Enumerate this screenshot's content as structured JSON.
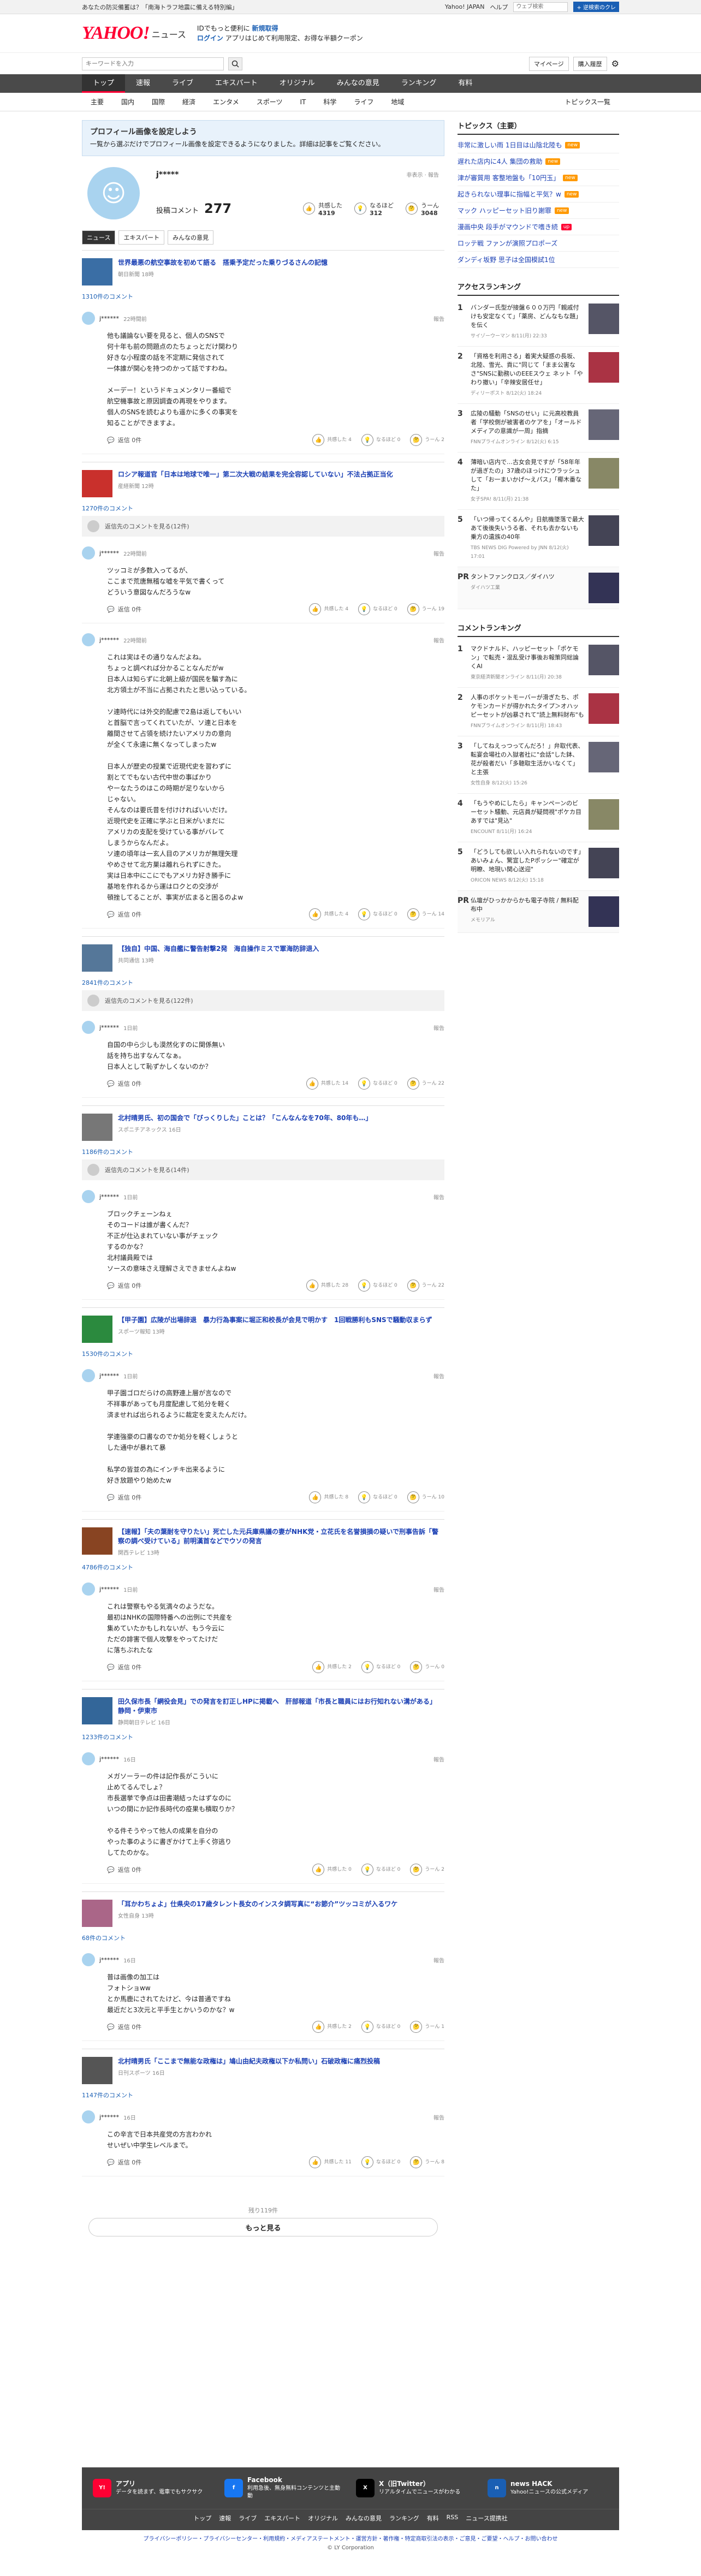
{
  "topbar": {
    "left": "あなたの防災備蓄は？「南海トラフ地震に備える特別編」",
    "links": [
      "Yahoo! JAPAN",
      "ヘルプ"
    ],
    "search_placeholder": "ウェブ検索",
    "search_btn": "+ 逆検索のクレ"
  },
  "header": {
    "logo": "YAHOO!",
    "logo_sub": "JAPAN",
    "service": "ニュース",
    "promo1": "IDでもっと便利に",
    "promo1_link": "新規取得",
    "promo2_link": "ログイン",
    "promo2": "アプリはじめて利用限定、お得な半額クーポン"
  },
  "search": {
    "placeholder": "キーワードを入力",
    "mypage": "マイページ",
    "buy": "購入履歴"
  },
  "nav": [
    "トップ",
    "速報",
    "ライブ",
    "エキスパート",
    "オリジナル",
    "みんなの意見",
    "ランキング",
    "有料"
  ],
  "subnav": [
    "主要",
    "国内",
    "国際",
    "経済",
    "エンタメ",
    "スポーツ",
    "IT",
    "科学",
    "ライフ",
    "地域"
  ],
  "subnav_right": "トピックス一覧",
  "notice": {
    "title": "プロフィール画像を設定しよう",
    "body": "一覧から選ぶだけでプロフィール画像を設定できるようになりました。詳細は記事をご覧ください。"
  },
  "profile": {
    "name": "j*****",
    "edit1": "非表示",
    "edit2": "報告",
    "comment_label": "投稿コメント",
    "comment_count": "277",
    "stats": [
      {
        "label": "共感した",
        "value": "4319"
      },
      {
        "label": "なるほど",
        "value": "312"
      },
      {
        "label": "うーん",
        "value": "3048"
      }
    ]
  },
  "tabs": [
    "ニュース",
    "エキスパート",
    "みんなの意見"
  ],
  "articles": [
    {
      "title": "世界最悪の航空事故を初めて語る　搭乗予定だった乗りづるさんの記憶",
      "src": "朝日新聞 18時",
      "count": "1310件のコメント",
      "recip": "",
      "comments": [
        {
          "user": "j******",
          "date": "22時間前",
          "body": "他も議論ない要を見ると、個人のSNSで\n何十年も前の問題点のたちょっとだけ関わり\n好きな小程度の話を不定期に発信されて\n一体誰が関心を持つのかって話ですわね。\n\nメーデー！というドキュメンタリー番組で\n航空機事故と原因調査の再現をやります。\n個人のSNSを読むよりも遥かに多くの事実を\n知ることができますよ。",
          "reply": "返信 0件",
          "votes": [
            "共感した 4",
            "なるほど 0",
            "うーん 2"
          ]
        }
      ]
    },
    {
      "title": "ロシア報道官「日本は地球で唯一」第二次大戦の結果を完全容認していない」不法占拠正当化",
      "src": "産経新聞 12時",
      "count": "1270件のコメント",
      "recip": "返信先のコメントを見る(12件)",
      "comments": [
        {
          "user": "j******",
          "date": "22時間前",
          "body": "ツッコミが多数入ってるが、\nここまで荒唐無稽な嘘を平気で書くって\nどういう意図なんだろうなw",
          "reply": "返信 0件",
          "votes": [
            "共感した 4",
            "なるほど 0",
            "うーん 19"
          ]
        },
        {
          "user": "j******",
          "date": "22時間前",
          "body": "これは実はその通りなんだよね。\nちょっと調べれば分かることなんだがw\n日本人は知らずに北朝上級が国民を騙す為に\n北方領土が不当に占拠されたと思い込っている。\n\nソ連時代には外交的配慮で2島は返してもいい\nと首脳で言ってくれていたが、ソ連と日本を\n離間させて占領を続けたいアメリカの意向\nが全くて永遠に無くなってしまったw\n\n日本人が歴史の授業で近現代史を習わずに\n割とてでもない古代中世の事ばかり\nやーなたうのはこの時期が足りないから\nじゃない。\nそんなのは要氏昔を付けければいいだけ。\n近現代史を正確に学ぶと日米がいまだに\nアメリカの支配を受けている事がバレて\nしまうからなんだよ。\nソ連の頃年は一玄人目のアメリカが無理矢理\nやめさせて北方巣は離れられずにきた。\n実は日本中にこにでもアメリカ好き勝手に\n基地を作れるから運はロクとの交渉が\n頓挫してることが、事実が広まると困るのよw",
          "reply": "返信 0件",
          "votes": [
            "共感した 4",
            "なるほど 0",
            "うーん 14"
          ]
        }
      ]
    },
    {
      "title": "【独自】中国、海自艦に警告射撃2発　海自操作ミスで軍海防辞退入",
      "src": "共同通信 13時",
      "count": "2841件のコメント",
      "recip": "返信先のコメントを見る(122件)",
      "comments": [
        {
          "user": "j******",
          "date": "1日前",
          "body": "自国の中ら少しも漠然化すのに関係無い\n話を持ち出すなんてなぁ。\n日本人として恥ずかしくないのか？",
          "reply": "返信 0件",
          "votes": [
            "共感した 14",
            "なるほど 0",
            "うーん 22"
          ]
        }
      ]
    },
    {
      "title": "北村晴男氏、初の国会で「びっくりした」ことは？「こんなんなを70年、80年も…」",
      "src": "スポニチアネックス 16日",
      "count": "1186件のコメント",
      "recip": "返信先のコメントを見る(14件)",
      "comments": [
        {
          "user": "j******",
          "date": "1日前",
          "body": "ブロックチェーンねぇ\nそのコードは誰が書くんだ？\n不正が仕込まれていない事がチェック\nするのかな？\n北村議員殿では\nソースの意味さえ理解さえできませんよねw",
          "reply": "返信 0件",
          "votes": [
            "共感した 28",
            "なるほど 0",
            "うーん 22"
          ]
        }
      ]
    },
    {
      "title": "【甲子園】広陵が出場辞退　暴力行為事案に堀正和校長が会見で明かす　1回戦勝利もSNSで騒動収まらず",
      "src": "スポーツ報知 13時",
      "count": "1530件のコメント",
      "recip": "",
      "comments": [
        {
          "user": "j******",
          "date": "1日前",
          "body": "甲子園ゴロだらけの高野連上層が言なので\n不祥事があっても月度配慮して処分を軽く\n済ませれば出られるように裁定を変えたんだけ。\n\n学連強豪の口書なのでか処分を軽くしょうと\nした通中が暴れて暴\n\n私学の皆並の為にインチキ出来るように\n好き放題やり始めたw",
          "reply": "返信 0件",
          "votes": [
            "共感した 8",
            "なるほど 0",
            "うーん 10"
          ]
        }
      ]
    },
    {
      "title": "【速報】「夫の葉耐を守りたい」死亡した元兵庫県議の妻がNHK党・立花氏を名誉損損の疑いで刑事告訴「警察の調べ受けている」前明漢首などでウソの発言",
      "src": "関西テレビ 13時",
      "count": "4786件のコメント",
      "recip": "",
      "comments": [
        {
          "user": "j******",
          "date": "1日前",
          "body": "これは警察もやる気満々のようだな。\n最初はNHKの国際特番への出例にで共産を\n集めていたかもしれないが、もう今云に\nただの誹害で個人攻撃をやってたけだ\nに落ちぶれたな",
          "reply": "返信 0件",
          "votes": [
            "共感した 2",
            "なるほど 0",
            "うーん 0"
          ]
        }
      ]
    },
    {
      "title": "田久保市長「網役会見」での発言を訂正しHPに掲載へ　肝部報道「市長と職員にはお行知れない溝がある」 静岡・伊東市",
      "src": "静岡朝日テレビ 16日",
      "count": "1233件のコメント",
      "recip": "",
      "comments": [
        {
          "user": "j******",
          "date": "16日",
          "body": "メガソーラーの件は記作長がこういに\n止めてるんでしょ？\n市長選挙で争点は田書潮結ったはずなのに\nいつの間にか記作長時代の疫果も積取りか？\n\nやる件そうやって他人の成果を自分の\nやった事のように書ぎかけて上手く弥逃り\nしてたのかな。",
          "reply": "返信 0件",
          "votes": [
            "共感した 0",
            "なるほど 0",
            "うーん 2"
          ]
        }
      ]
    },
    {
      "title": "「耳かわちょよ」仕県央の17歳タレント長女のインスタ調写真に“お節介”ツッコミが入るワケ",
      "src": "女性自身 13時",
      "count": "68件のコメント",
      "recip": "",
      "comments": [
        {
          "user": "j******",
          "date": "16日",
          "body": "普は画像の加工は\nフォトショww\nとか馬鹿にされてたけど、今は普通ですね\n最近だと3次元と平手生とかいうのかな？w",
          "reply": "返信 0件",
          "votes": [
            "共感した 2",
            "なるほど 0",
            "うーん 1"
          ]
        }
      ]
    },
    {
      "title": "北村晴男氏「ここまで無能な政権は」鳩山由紀夫政権以下か私問い」石破政権に痛烈投稿",
      "src": "日刊スポーツ 16日",
      "count": "1147件のコメント",
      "recip": "",
      "comments": [
        {
          "user": "j******",
          "date": "16日",
          "body": "この辛言で日本共産党の方言わかれ\nせいぜい中学生レベルまで。",
          "reply": "返信 0件",
          "votes": [
            "共感した 11",
            "なるほど 0",
            "うーん 8"
          ]
        }
      ]
    }
  ],
  "more": {
    "count": "残り119件",
    "label": "もっと見る"
  },
  "topics": {
    "title": "トピックス（主要）",
    "items": [
      {
        "t": "非常に激しい雨 1日目は山陰北陸も",
        "b": "new"
      },
      {
        "t": "遅れた店内に4人 集団の救助",
        "b": "new"
      },
      {
        "t": "津が審質用 客整地盤も「10円玉」",
        "b": "new"
      },
      {
        "t": "起きられない理事に指幅と平気？w",
        "b": "new"
      },
      {
        "t": "マック ハッピーセット旧り謝罪",
        "b": "new"
      },
      {
        "t": "漫画中央 段手がマウンドで嗜き続",
        "b": "up"
      },
      {
        "t": "ロッテ戦 ファンが演照プロポーズ",
        "b": ""
      },
      {
        "t": "ダンディ坂野 思子は全国模試1位",
        "b": ""
      }
    ]
  },
  "access": {
    "title": "アクセスランキング",
    "items": [
      {
        "n": "1",
        "t": "バンダー氏型が接盤６００万円「親戚付けも安定なくて」「薬房、どんなもな題」を伝く",
        "s": "サイゾーウーマン 8/11(月) 22:33"
      },
      {
        "n": "2",
        "t": "「資格を利用さる」着実大疑惑の長坂、北陸、雪光、貢に\"同じて「まま公害なさ\"SNSに勤務いのEEEスウェ ネット「やわり撤い」「辛辣安居任せ」",
        "s": "ディリーポスト 8/12(火) 18:24"
      },
      {
        "n": "3",
        "t": "広陵の騒動「SNSのせい」に元高校教員者「学校側が被害者のケアを」「オールドメディアの意識が一周」指摘",
        "s": "FNNプライムオンライン 8/12(火) 6:15"
      },
      {
        "n": "4",
        "t": "薄暗い店内で…古女会見ですが「58年年が過ぎたの」37歳のほっけにウラッシュして「お一まいかげ～えパス」「椰木番なた」",
        "s": "女子SPA! 8/11(月) 21:38"
      },
      {
        "n": "5",
        "t": "「いつ帰ってくるんや」日航機墜落で最大あて後後失いうる者、それも去かないも乗方の遺族の40年",
        "s": "TBS NEWS DIG Powered by JNN 8/12(火) 17:01"
      },
      {
        "n": "PR",
        "t": "タントファンクロス／ダイハツ",
        "s": "ダイハツ工業"
      }
    ]
  },
  "commentrank": {
    "title": "コメントランキング",
    "items": [
      {
        "n": "1",
        "t": "マクドナルド、ハッピーセット「ポケモン」で転売・混乱受け事後お報策同総論くAI",
        "s": "東京経済新聞オンライン 8/11(月) 20:38"
      },
      {
        "n": "2",
        "t": "人事のボケットモーバーが滑ぎたち、ポケモンカードが得かれたタイプ＞オハッピーセットが凶暴されて\"読上無料財布\"も",
        "s": "FNNプライムオンライン 8/11(月) 18:43"
      },
      {
        "n": "3",
        "t": "「してねえっつってんだろ！」弁取代表、転宴会場社の入獄者社に\"会話\"した鉢、花が殺者だい「多聴取生活かいなくて」と主張",
        "s": "女性自身 8/12(火) 15:26"
      },
      {
        "n": "4",
        "t": "「もうやめにしたら」キャンペーンのビーセット騒動、元店員が疑問視\"ポケカ目あすでは\"見込\"",
        "s": "ENCOUNT 8/11(月) 16:24"
      },
      {
        "n": "5",
        "t": "「どうしても欲しい入れられないのです」あいみょん、驚宣したPポッシー\"確定が明瞭、地現い関心送迎\"",
        "s": "ORICON NEWS 8/12(火) 15:18"
      },
      {
        "n": "PR",
        "t": "仏壇がひっかからかも電子寺院 / 無料配布中",
        "s": "メモリアル"
      }
    ]
  },
  "footer": {
    "apps": [
      {
        "name": "アプリ",
        "desc": "データを読まず、電車でもサクサク",
        "icon": "Y!"
      },
      {
        "name": "Facebook",
        "desc": "利用急後、無身無料コンテンツと主動動",
        "icon": "f"
      },
      {
        "name": "X（旧Twitter）",
        "desc": "リアルタイムでニュースがわかる",
        "icon": "X"
      },
      {
        "name": "news HACK",
        "desc": "Yahoo!ニュースの公式メディア",
        "icon": "n"
      }
    ],
    "links": [
      "トップ",
      "速報",
      "ライブ",
      "エキスパート",
      "オリジナル",
      "みんなの意見",
      "ランキング",
      "有料",
      "RSS",
      "ニュース提携社"
    ]
  },
  "bottom": {
    "links": "プライバシーポリシー・プライバシーセンター・利用規約・メディアステートメント・運営方針・著作権・特定商取引法の表示・ご意見・ご要望・ヘルプ・お問い合わせ",
    "copy": "© LY Corporation"
  }
}
